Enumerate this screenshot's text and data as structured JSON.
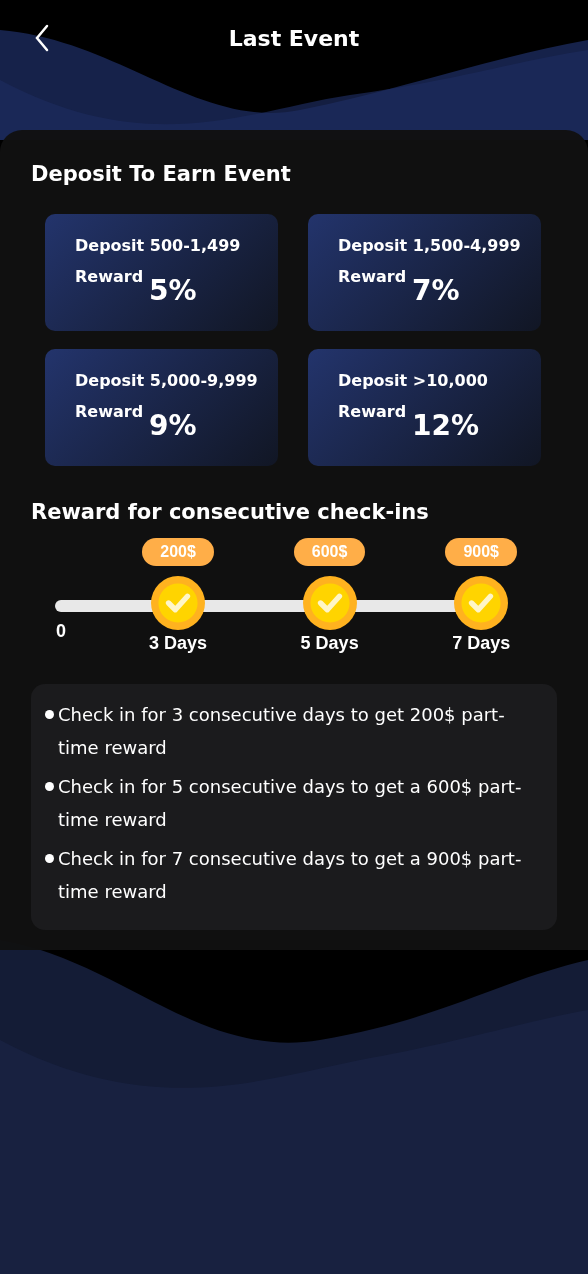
{
  "header": {
    "title": "Last Event"
  },
  "deposit": {
    "title": "Deposit To Earn Event",
    "tiers": [
      {
        "range": "Deposit 500-1,499",
        "reward_label": "Reward",
        "reward": "5%"
      },
      {
        "range": "Deposit 1,500-4,999",
        "reward_label": "Reward",
        "reward": "7%"
      },
      {
        "range": "Deposit 5,000-9,999",
        "reward_label": "Reward",
        "reward": "9%"
      },
      {
        "range": "Deposit >10,000",
        "reward_label": "Reward",
        "reward": "12%"
      }
    ]
  },
  "checkins": {
    "title": "Reward for consecutive check-ins",
    "start_label": "0",
    "milestones": [
      {
        "amount": "200$",
        "days": "3 Days",
        "checked": true
      },
      {
        "amount": "600$",
        "days": "5 Days",
        "checked": true
      },
      {
        "amount": "900$",
        "days": "7 Days",
        "checked": true
      }
    ],
    "rules": [
      "Check in for 3 consecutive days to get 200$ part-time reward",
      "Check in for 5 consecutive days to get a 600$ part-time reward",
      "Check in for 7 consecutive days to get a 900$ part-time reward"
    ]
  }
}
